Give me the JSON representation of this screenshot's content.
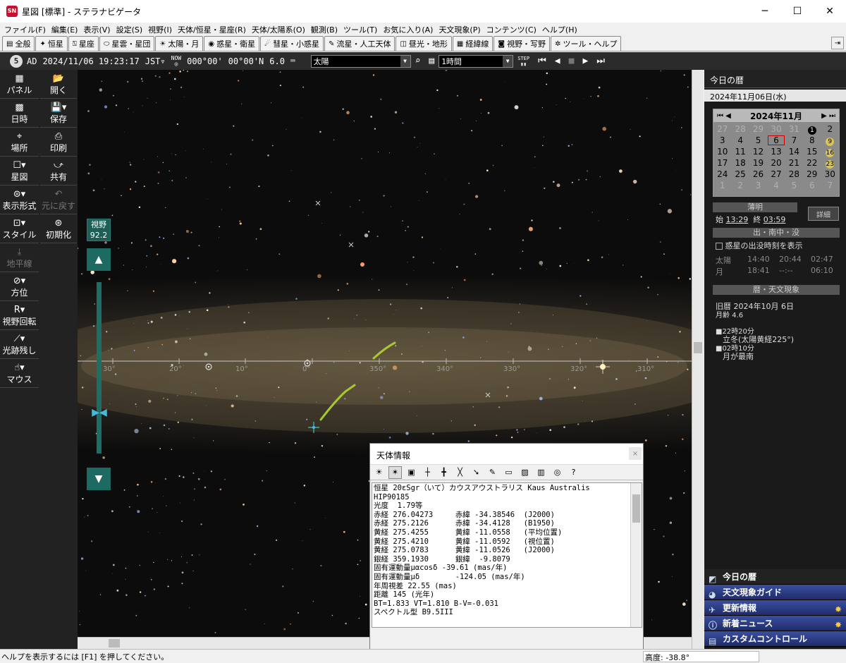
{
  "window": {
    "title": "星図 [標準] - ステラナビゲータ",
    "app_icon": "SN"
  },
  "window_buttons": {
    "minimize": "─",
    "maximize": "☐",
    "close": "✕"
  },
  "menu": [
    "ファイル(F)",
    "編集(E)",
    "表示(V)",
    "設定(S)",
    "視野(I)",
    "天体/恒星・星座(R)",
    "天体/太陽系(O)",
    "観測(B)",
    "ツール(T)",
    "お気に入り(A)",
    "天文現象(P)",
    "コンテンツ(C)",
    "ヘルプ(H)"
  ],
  "tabs": [
    {
      "label": "全般",
      "icon": "▤"
    },
    {
      "label": "恒星",
      "icon": "✦"
    },
    {
      "label": "星座",
      "icon": "⍂"
    },
    {
      "label": "星雲・星団",
      "icon": "⬭"
    },
    {
      "label": "太陽・月",
      "icon": "☀"
    },
    {
      "label": "惑星・衛星",
      "icon": "◉"
    },
    {
      "label": "彗星・小惑星",
      "icon": "☄"
    },
    {
      "label": "流星・人工天体",
      "icon": "✎"
    },
    {
      "label": "昼光・地形",
      "icon": "◫"
    },
    {
      "label": "経緯線",
      "icon": "▦"
    },
    {
      "label": "視野・写野",
      "icon": "◙"
    },
    {
      "label": "ツール・ヘルプ",
      "icon": "✲"
    }
  ],
  "datebar": {
    "circle": "5",
    "era": "AD",
    "datetime": "2024/11/06 19:23:17",
    "tz": "JST▿",
    "now": "NOW",
    "lon": "000°00'",
    "lat": "00°00'N",
    "mag": "6.0",
    "target": "太陽",
    "step": "1時間",
    "step_label": "STEP"
  },
  "left_col1": [
    {
      "label": "パネル",
      "icon": "▦"
    },
    {
      "label": "日時",
      "icon": "▩"
    },
    {
      "label": "場所",
      "icon": "⌖"
    },
    {
      "label": "星図",
      "icon": "☐▾"
    },
    {
      "label": "表示形式",
      "icon": "⊜▾"
    },
    {
      "label": "スタイル",
      "icon": "⊡▾"
    },
    {
      "label": "地平線",
      "icon": "⤓",
      "dim": true
    },
    {
      "label": "方位",
      "icon": "⊘▾"
    },
    {
      "label": "視野回転",
      "icon": "R▾"
    },
    {
      "label": "光跡残し",
      "icon": "⟋▾"
    },
    {
      "label": "マウス",
      "icon": "☝▾"
    }
  ],
  "left_col2": [
    {
      "label": "開く",
      "icon": "📂"
    },
    {
      "label": "保存",
      "icon": "💾▾"
    },
    {
      "label": "印刷",
      "icon": "⎙"
    },
    {
      "label": "共有",
      "icon": "⤻"
    },
    {
      "label": "元に戻す",
      "icon": "↶",
      "dim": true
    },
    {
      "label": "初期化",
      "icon": "⊛"
    }
  ],
  "fov": {
    "label": "視野",
    "value": "92.2"
  },
  "sky_labels": {
    "ecliptic_ticks": [
      "30°",
      "20°",
      "10°",
      "0°",
      "350°",
      "340°",
      "330°",
      "320°",
      "310°"
    ]
  },
  "info_window": {
    "title": "天体情報",
    "close": "×",
    "lines": [
      "恒星 20εSgr（いて）カウスアウストラリス Kaus Australis",
      "HIP90185",
      "光度  1.79等",
      "赤経 276.04273     赤緯 -34.38546  (J2000)",
      "赤経 275.2126      赤緯 -34.4128   (B1950)",
      "黄経 275.4255      黄緯 -11.0558   (平均位置)",
      "黄経 275.4210      黄緯 -11.0592   (視位置)",
      "黄経 275.0783      黄緯 -11.0526   (J2000)",
      "銀経 359.1930      銀緯  -9.8079",
      "固有運動量μαcosδ -39.61 (mas/年)",
      "固有運動量μδ        -124.05 (mas/年)",
      "年周視差 22.55 (mas)",
      "距離 145 (光年)",
      "BT=1.833 VT=1.810 B-V=-0.031",
      "スペクトル型 B9.5III"
    ]
  },
  "right_panel": {
    "header": "今日の暦",
    "date": "2024年11月06日(水)",
    "calendar": {
      "month": "2024年11月",
      "weeks": [
        [
          {
            "d": "27",
            "o": true
          },
          {
            "d": "28",
            "o": true
          },
          {
            "d": "29",
            "o": true
          },
          {
            "d": "30",
            "o": true
          },
          {
            "d": "31",
            "o": true
          },
          {
            "d": "1",
            "m": "new"
          },
          {
            "d": "2"
          }
        ],
        [
          {
            "d": "3"
          },
          {
            "d": "4"
          },
          {
            "d": "5"
          },
          {
            "d": "6",
            "today": true
          },
          {
            "d": "7"
          },
          {
            "d": "8"
          },
          {
            "d": "9",
            "m": "q"
          }
        ],
        [
          {
            "d": "10"
          },
          {
            "d": "11"
          },
          {
            "d": "12"
          },
          {
            "d": "13"
          },
          {
            "d": "14"
          },
          {
            "d": "15"
          },
          {
            "d": "16",
            "m": "q"
          }
        ],
        [
          {
            "d": "17"
          },
          {
            "d": "18"
          },
          {
            "d": "19"
          },
          {
            "d": "20"
          },
          {
            "d": "21"
          },
          {
            "d": "22"
          },
          {
            "d": "23",
            "m": "q"
          }
        ],
        [
          {
            "d": "24"
          },
          {
            "d": "25"
          },
          {
            "d": "26"
          },
          {
            "d": "27"
          },
          {
            "d": "28"
          },
          {
            "d": "29"
          },
          {
            "d": "30"
          }
        ],
        [
          {
            "d": "1",
            "o": true
          },
          {
            "d": "2",
            "o": true
          },
          {
            "d": "3",
            "o": true
          },
          {
            "d": "4",
            "o": true
          },
          {
            "d": "5",
            "o": true
          },
          {
            "d": "6",
            "o": true
          },
          {
            "d": "7",
            "o": true
          }
        ]
      ]
    },
    "twilight_title": "薄明",
    "twilight_start_label": "始",
    "twilight_start": "13:29",
    "twilight_end_label": "終",
    "twilight_end": "03:59",
    "detail_button": "詳細",
    "rise_title": "出・南中・没",
    "planet_checkbox": "惑星の出没時刻を表示",
    "sun_row": [
      "太陽",
      "14:40",
      "20:44",
      "02:47"
    ],
    "moon_row": [
      "月",
      "18:41",
      "--:--",
      "06:10"
    ],
    "events_title": "暦・天文現象",
    "lunar_date": "旧暦  2024年10月 6日",
    "moon_age": "月齢 4.6",
    "event1_time": "■22時20分",
    "event1_text": "立冬(太陽黄経225°)",
    "event2_time": "■02時10分",
    "event2_text": "月が最南",
    "nav": [
      {
        "label": "今日の暦",
        "icon": "◩",
        "active": true
      },
      {
        "label": "天文現象ガイド",
        "icon": "◕"
      },
      {
        "label": "更新情報",
        "icon": "✈",
        "spark": true
      },
      {
        "label": "新着ニュース",
        "icon": "ⓘ",
        "spark": true
      },
      {
        "label": "カスタムコントロール",
        "icon": "▤"
      }
    ]
  },
  "status": {
    "help": "ヘルプを表示するには [F1] を押してください。",
    "altitude": "高度: -38.8°"
  }
}
